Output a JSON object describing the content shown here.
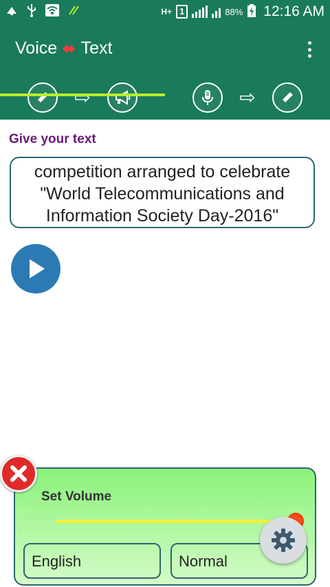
{
  "status": {
    "network_label": "H+",
    "sim_slot": "1",
    "battery": "88%",
    "time": "12:16 AM"
  },
  "app": {
    "title_left": "Voice",
    "title_right": "Text",
    "swap_glyph": "⬌"
  },
  "tabs": [
    {
      "from_icon": "pencil-icon",
      "to_icon": "megaphone-icon",
      "active": true
    },
    {
      "from_icon": "microphone-icon",
      "to_icon": "pencil-icon",
      "active": false
    }
  ],
  "main": {
    "prompt_label": "Give your text",
    "text_lines": [
      "competition arranged to celebrate",
      "\"World Telecommunications and",
      "Information Society Day-2016\""
    ]
  },
  "panel": {
    "title": "Set Volume",
    "volume_fraction": 1.0,
    "language_value": "English",
    "speed_value": "Normal"
  },
  "colors": {
    "app_bar": "#1a7a5c",
    "tab_indicator": "#b8f02a",
    "prompt_label": "#6b1a7a",
    "play_button": "#2b7ab3",
    "close_button": "#e02a2a"
  }
}
